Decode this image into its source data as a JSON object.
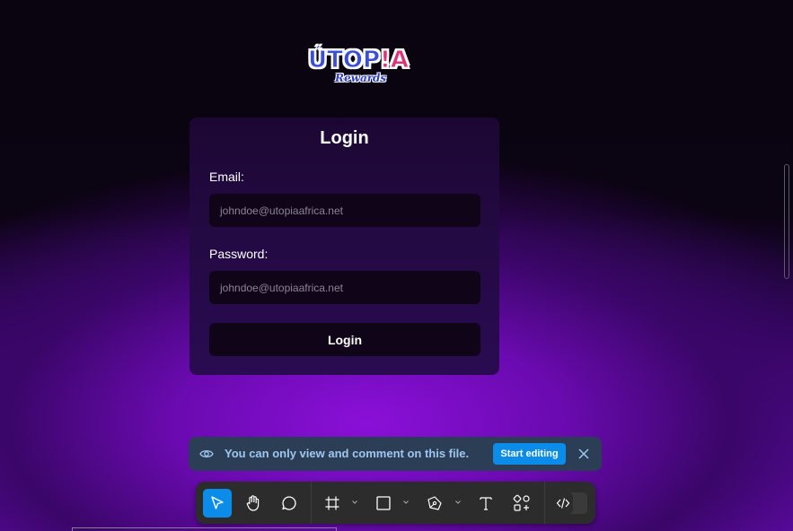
{
  "logo": {
    "top_text": "ÚTOP!A",
    "sub_text": "Rewards"
  },
  "form": {
    "title": "Login",
    "email_label": "Email:",
    "email_placeholder": "johndoe@utopiaafrica.net",
    "password_label": "Password:",
    "password_placeholder": "johndoe@utopiaafrica.net",
    "submit_label": "Login"
  },
  "banner": {
    "message": "You can only view and comment on this file.",
    "start_editing_label": "Start editing"
  },
  "toolbar": {
    "tools": [
      {
        "name": "move-tool",
        "icon": "cursor-icon",
        "active": true
      },
      {
        "name": "hand-tool",
        "icon": "hand-icon",
        "active": false
      },
      {
        "name": "comment-tool",
        "icon": "comment-icon",
        "active": false
      },
      {
        "name": "frame-tool",
        "icon": "frame-icon",
        "active": false
      },
      {
        "name": "shape-tool",
        "icon": "rectangle-icon",
        "active": false
      },
      {
        "name": "pen-tool",
        "icon": "pen-icon",
        "active": false
      },
      {
        "name": "text-tool",
        "icon": "text-icon",
        "active": false
      },
      {
        "name": "resources-tool",
        "icon": "resources-icon",
        "active": false
      },
      {
        "name": "dev-mode-toggle",
        "icon": "code-icon",
        "active": false
      }
    ]
  },
  "colors": {
    "accent": "#0c8ce9",
    "banner_bg": "#2c3e55",
    "banner_text": "#9ec6ef",
    "background_purple": "#8a10d8"
  }
}
